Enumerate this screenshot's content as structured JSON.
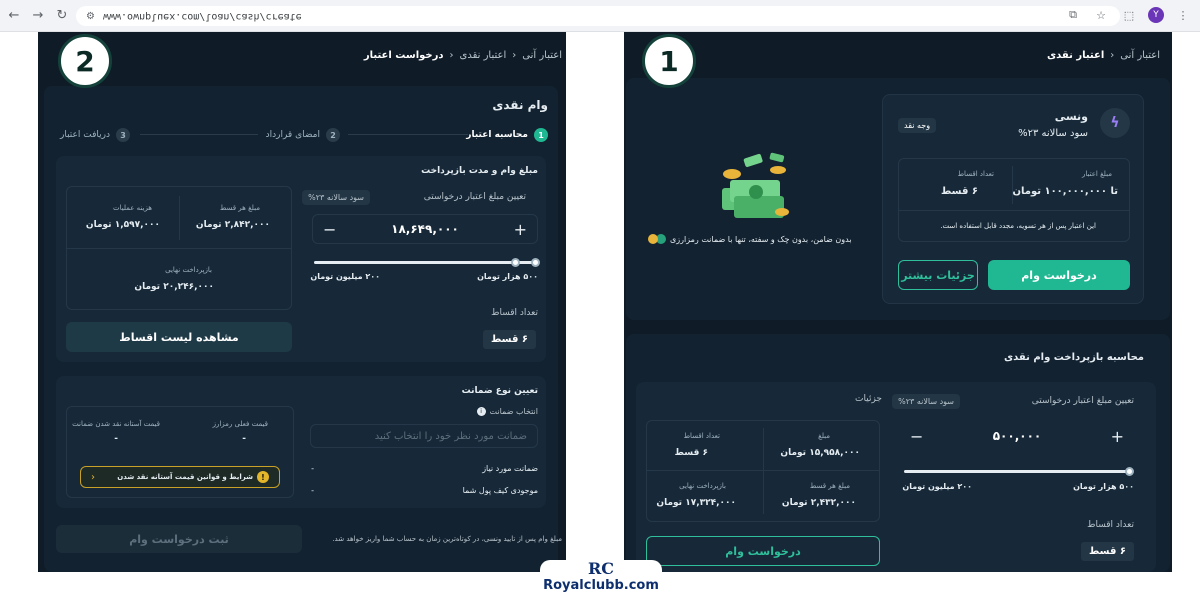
{
  "browser": {
    "url": "www.ownpluex.com/loan/cash/create"
  },
  "left": {
    "badge": "2",
    "breadcrumb": [
      "اعتبار آنی",
      "اعتبار نقدی",
      "درخواست اعتبار"
    ],
    "title": "وام نقدی",
    "steps": [
      {
        "num": "1",
        "label": "محاسبه اعتبار"
      },
      {
        "num": "2",
        "label": "امضای قرارداد"
      },
      {
        "num": "3",
        "label": "دریافت اعتبار"
      }
    ],
    "section1_title": "مبلغ وام و مدت بازپرداخت",
    "amount_label": "تعیین مبلغ اعتبار درخواستی",
    "interest_pill": "سود سالانه ۲۳%",
    "amount_value": "۱۸,۶۴۹,۰۰۰",
    "slider_min": "۵۰۰ هزار تومان",
    "slider_max": "۲۰۰ میلیون تومان",
    "installments_label": "تعداد اقساط",
    "installments_chip": "۶ قسط",
    "summary": {
      "per_installment_label": "مبلغ هر قسط",
      "per_installment_value": "۲,۸۴۲,۰۰۰ تومان",
      "fee_label": "هزینه عملیات",
      "fee_value": "۱,۵۹۷,۰۰۰ تومان",
      "final_label": "بازپرداخت نهایی",
      "final_value": "۲۰,۲۴۶,۰۰۰ تومان"
    },
    "view_list_button": "مشاهده لیست اقساط",
    "guarantee_title": "تعیین نوع ضمانت",
    "choose_guarantee": "انتخاب ضمانت",
    "guarantee_placeholder": "ضمانت مورد نظر خود را انتخاب کنید",
    "required_guarantee": "ضمانت مورد نیاز",
    "wallet_balance": "موجودی کیف پول شما",
    "dash": "-",
    "crypto_price_label": "قیمت فعلی رمزارز",
    "threshold_label": "قیمت آستانه نقد شدن ضمانت",
    "rules_link": "شرایط و قوانین قیمت آستانه نقد شدن",
    "note": "مبلغ وام پس از تایید ونسی، در کوتاه‌ترین زمان به حساب شما واریز خواهد شد.",
    "submit_button": "ثبت درخواست وام"
  },
  "right": {
    "badge": "1",
    "breadcrumb": [
      "اعتبار آنی",
      "اعتبار نقدی"
    ],
    "product_name": "ونسی",
    "product_interest": "سود سالانه ۲۳%",
    "cash_tag": "وجه نقد",
    "credit_amount_label": "مبلغ اعتبار",
    "credit_amount_value": "تا ۱۰۰,۰۰۰,۰۰۰ تومان",
    "installments_label": "تعداد اقساط",
    "installments_value": "۶ قسط",
    "reuse_note": "این اعتبار پس از هر تسویه، مجدد قابل استفاده است.",
    "request_button": "درخواست وام",
    "details_button": "جزئیات بیشتر",
    "promo_text": "بدون ضامن، بدون چک و سفته، تنها با ضمانت رمزارزی",
    "calc_title": "محاسبه بازپرداخت وام نقدی",
    "amount_label": "تعیین مبلغ اعتبار درخواستی",
    "interest_pill": "سود سالانه ۲۳%",
    "amount_value": "۵۰۰,۰۰۰",
    "slider_min": "۵۰۰ هزار تومان",
    "slider_max": "۲۰۰ میلیون تومان",
    "installments_label2": "تعداد اقساط",
    "installments_chip": "۶ قسط",
    "details_label": "جزئیات",
    "summary": {
      "amount_label": "مبلغ",
      "amount_value": "۱۵,۹۵۸,۰۰۰ تومان",
      "count_label": "تعداد اقساط",
      "count_value": "۶ قسط",
      "per_installment_label": "مبلغ هر قسط",
      "per_installment_value": "۲,۴۳۲,۰۰۰ تومان",
      "final_label": "بازپرداخت نهایی",
      "final_value": "۱۷,۳۲۴,۰۰۰ تومان"
    },
    "request_button2": "درخواست وام"
  },
  "watermark": {
    "mark": "RC",
    "text": "Royalclubb.com"
  }
}
